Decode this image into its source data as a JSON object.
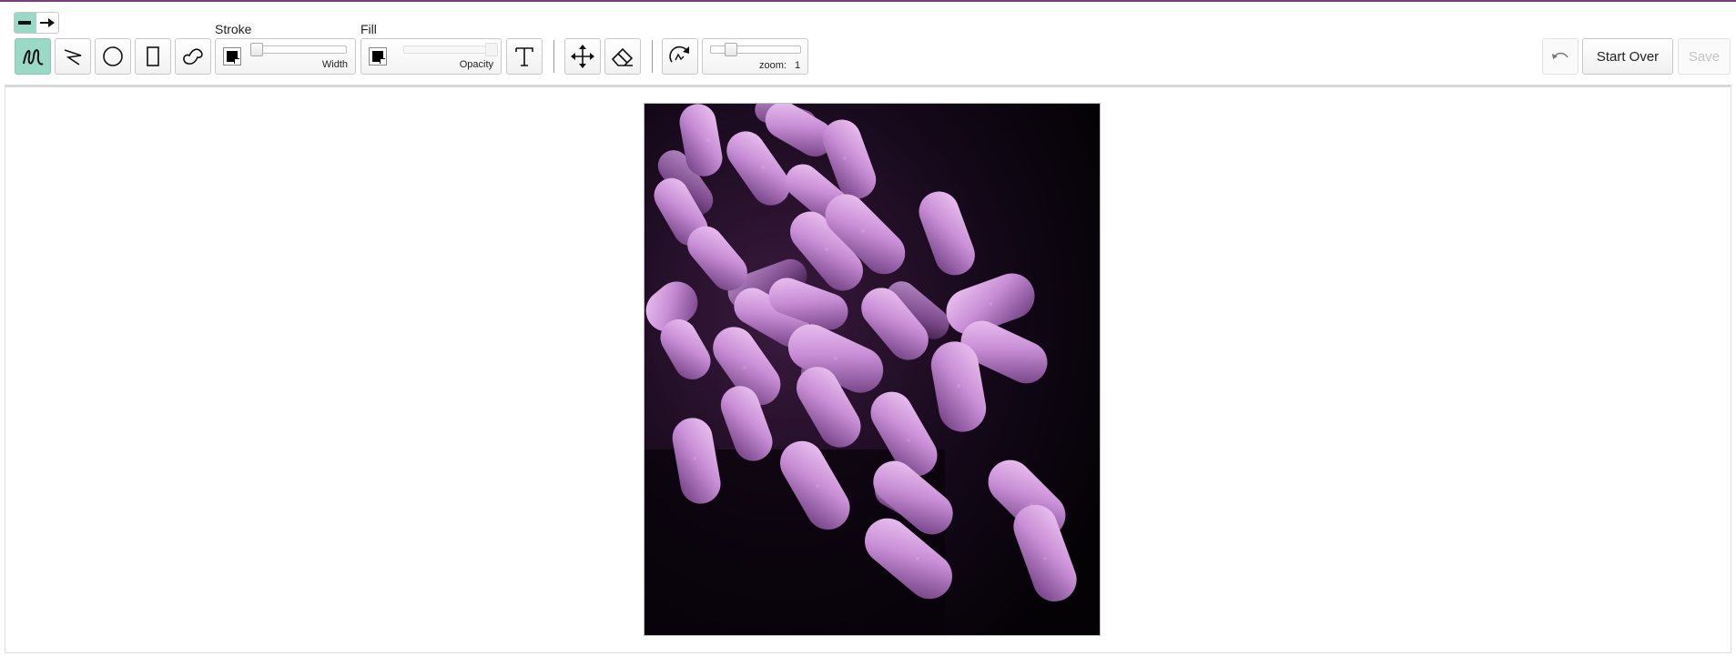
{
  "toolbar": {
    "line_mode": {
      "options": [
        "plain-line",
        "arrow-line"
      ],
      "selected": "plain-line"
    },
    "tools": [
      {
        "name": "freehand-tool",
        "icon": "freehand-squiggle-icon",
        "active": true
      },
      {
        "name": "line-tool",
        "icon": "polyline-icon",
        "active": false
      },
      {
        "name": "circle-tool",
        "icon": "circle-icon",
        "active": false
      },
      {
        "name": "rectangle-tool",
        "icon": "rectangle-icon",
        "active": false
      },
      {
        "name": "shape-tool",
        "icon": "blob-shape-icon",
        "active": false
      }
    ],
    "stroke": {
      "label": "Stroke",
      "slider_label": "Width",
      "color": "#000000",
      "width_value": 0
    },
    "fill": {
      "label": "Fill",
      "slider_label": "Opacity",
      "color": "#000000",
      "opacity_value": 1,
      "disabled": true
    },
    "text_tool": {
      "icon": "text-T-icon"
    },
    "move_tool": {
      "icon": "move-arrows-icon"
    },
    "eraser_tool": {
      "icon": "eraser-icon"
    },
    "rotate_tool": {
      "icon": "rotate-icon"
    },
    "zoom": {
      "label": "zoom:",
      "value": "1"
    },
    "undo": {
      "icon": "undo-icon",
      "disabled": true
    },
    "start_over_label": "Start Over",
    "save_label": "Save",
    "save_disabled": true
  },
  "canvas": {
    "image_description_icon": "bacteria-micrograph-image"
  },
  "colors": {
    "accent": "#9ad9c6",
    "top_border": "#7a3c7a",
    "bacteria": "#c98fd6",
    "photo_background": "#060307"
  }
}
